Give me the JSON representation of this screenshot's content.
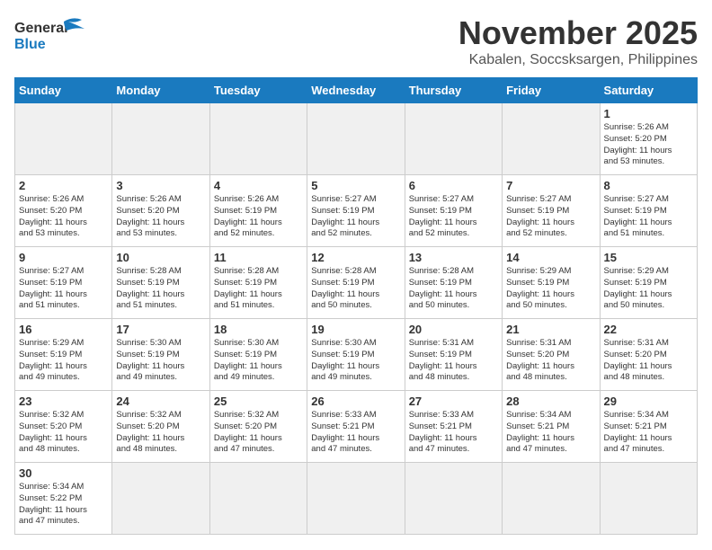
{
  "header": {
    "logo_general": "General",
    "logo_blue": "Blue",
    "month": "November 2025",
    "location": "Kabalen, Soccsksargen, Philippines"
  },
  "weekdays": [
    "Sunday",
    "Monday",
    "Tuesday",
    "Wednesday",
    "Thursday",
    "Friday",
    "Saturday"
  ],
  "weeks": [
    [
      {
        "day": "",
        "info": ""
      },
      {
        "day": "",
        "info": ""
      },
      {
        "day": "",
        "info": ""
      },
      {
        "day": "",
        "info": ""
      },
      {
        "day": "",
        "info": ""
      },
      {
        "day": "",
        "info": ""
      },
      {
        "day": "1",
        "info": "Sunrise: 5:26 AM\nSunset: 5:20 PM\nDaylight: 11 hours\nand 53 minutes."
      }
    ],
    [
      {
        "day": "2",
        "info": "Sunrise: 5:26 AM\nSunset: 5:20 PM\nDaylight: 11 hours\nand 53 minutes."
      },
      {
        "day": "3",
        "info": "Sunrise: 5:26 AM\nSunset: 5:20 PM\nDaylight: 11 hours\nand 53 minutes."
      },
      {
        "day": "4",
        "info": "Sunrise: 5:26 AM\nSunset: 5:19 PM\nDaylight: 11 hours\nand 52 minutes."
      },
      {
        "day": "5",
        "info": "Sunrise: 5:27 AM\nSunset: 5:19 PM\nDaylight: 11 hours\nand 52 minutes."
      },
      {
        "day": "6",
        "info": "Sunrise: 5:27 AM\nSunset: 5:19 PM\nDaylight: 11 hours\nand 52 minutes."
      },
      {
        "day": "7",
        "info": "Sunrise: 5:27 AM\nSunset: 5:19 PM\nDaylight: 11 hours\nand 52 minutes."
      },
      {
        "day": "8",
        "info": "Sunrise: 5:27 AM\nSunset: 5:19 PM\nDaylight: 11 hours\nand 51 minutes."
      }
    ],
    [
      {
        "day": "9",
        "info": "Sunrise: 5:27 AM\nSunset: 5:19 PM\nDaylight: 11 hours\nand 51 minutes."
      },
      {
        "day": "10",
        "info": "Sunrise: 5:28 AM\nSunset: 5:19 PM\nDaylight: 11 hours\nand 51 minutes."
      },
      {
        "day": "11",
        "info": "Sunrise: 5:28 AM\nSunset: 5:19 PM\nDaylight: 11 hours\nand 51 minutes."
      },
      {
        "day": "12",
        "info": "Sunrise: 5:28 AM\nSunset: 5:19 PM\nDaylight: 11 hours\nand 50 minutes."
      },
      {
        "day": "13",
        "info": "Sunrise: 5:28 AM\nSunset: 5:19 PM\nDaylight: 11 hours\nand 50 minutes."
      },
      {
        "day": "14",
        "info": "Sunrise: 5:29 AM\nSunset: 5:19 PM\nDaylight: 11 hours\nand 50 minutes."
      },
      {
        "day": "15",
        "info": "Sunrise: 5:29 AM\nSunset: 5:19 PM\nDaylight: 11 hours\nand 50 minutes."
      }
    ],
    [
      {
        "day": "16",
        "info": "Sunrise: 5:29 AM\nSunset: 5:19 PM\nDaylight: 11 hours\nand 49 minutes."
      },
      {
        "day": "17",
        "info": "Sunrise: 5:30 AM\nSunset: 5:19 PM\nDaylight: 11 hours\nand 49 minutes."
      },
      {
        "day": "18",
        "info": "Sunrise: 5:30 AM\nSunset: 5:19 PM\nDaylight: 11 hours\nand 49 minutes."
      },
      {
        "day": "19",
        "info": "Sunrise: 5:30 AM\nSunset: 5:19 PM\nDaylight: 11 hours\nand 49 minutes."
      },
      {
        "day": "20",
        "info": "Sunrise: 5:31 AM\nSunset: 5:19 PM\nDaylight: 11 hours\nand 48 minutes."
      },
      {
        "day": "21",
        "info": "Sunrise: 5:31 AM\nSunset: 5:20 PM\nDaylight: 11 hours\nand 48 minutes."
      },
      {
        "day": "22",
        "info": "Sunrise: 5:31 AM\nSunset: 5:20 PM\nDaylight: 11 hours\nand 48 minutes."
      }
    ],
    [
      {
        "day": "23",
        "info": "Sunrise: 5:32 AM\nSunset: 5:20 PM\nDaylight: 11 hours\nand 48 minutes."
      },
      {
        "day": "24",
        "info": "Sunrise: 5:32 AM\nSunset: 5:20 PM\nDaylight: 11 hours\nand 48 minutes."
      },
      {
        "day": "25",
        "info": "Sunrise: 5:32 AM\nSunset: 5:20 PM\nDaylight: 11 hours\nand 47 minutes."
      },
      {
        "day": "26",
        "info": "Sunrise: 5:33 AM\nSunset: 5:21 PM\nDaylight: 11 hours\nand 47 minutes."
      },
      {
        "day": "27",
        "info": "Sunrise: 5:33 AM\nSunset: 5:21 PM\nDaylight: 11 hours\nand 47 minutes."
      },
      {
        "day": "28",
        "info": "Sunrise: 5:34 AM\nSunset: 5:21 PM\nDaylight: 11 hours\nand 47 minutes."
      },
      {
        "day": "29",
        "info": "Sunrise: 5:34 AM\nSunset: 5:21 PM\nDaylight: 11 hours\nand 47 minutes."
      }
    ],
    [
      {
        "day": "30",
        "info": "Sunrise: 5:34 AM\nSunset: 5:22 PM\nDaylight: 11 hours\nand 47 minutes."
      },
      {
        "day": "",
        "info": ""
      },
      {
        "day": "",
        "info": ""
      },
      {
        "day": "",
        "info": ""
      },
      {
        "day": "",
        "info": ""
      },
      {
        "day": "",
        "info": ""
      },
      {
        "day": "",
        "info": ""
      }
    ]
  ]
}
